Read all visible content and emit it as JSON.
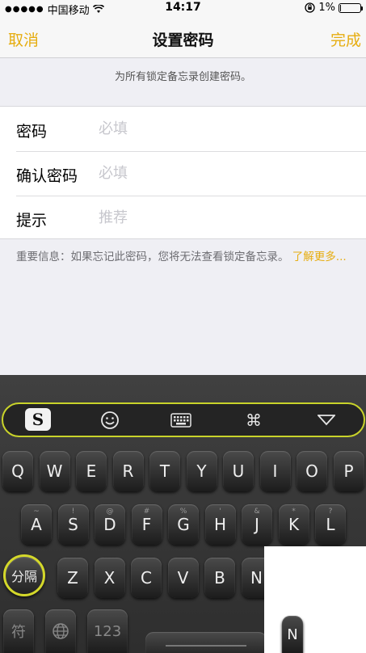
{
  "status_bar": {
    "carrier": "中国移动",
    "time": "14:17",
    "battery": "1%",
    "battery_level": 0.01,
    "icons": [
      "signal-dots-icon",
      "wifi-icon",
      "orientation-lock-icon",
      "battery-icon"
    ]
  },
  "nav": {
    "cancel": "取消",
    "title": "设置密码",
    "done": "完成",
    "accent_color": "#e6ad10"
  },
  "notice": "为所有锁定备忘录创建密码。",
  "form": {
    "password_label": "密码",
    "password_placeholder": "必填",
    "confirm_label": "确认密码",
    "confirm_placeholder": "必填",
    "hint_label": "提示",
    "hint_placeholder": "推荐"
  },
  "info": {
    "text": "重要信息：如果忘记此密码，您将无法查看锁定备忘录。",
    "link": "了解更多..."
  },
  "keyboard": {
    "toolbar_icons": [
      "sogou-logo-icon",
      "emoji-icon",
      "keyboard-icon",
      "command-icon",
      "collapse-icon"
    ],
    "sogou_label": "S",
    "row1": [
      "Q",
      "W",
      "E",
      "R",
      "T",
      "Y",
      "U",
      "I",
      "O",
      "P"
    ],
    "row2": [
      "A",
      "S",
      "D",
      "F",
      "G",
      "H",
      "J",
      "K",
      "L"
    ],
    "row2_subs": [
      "~",
      "!",
      "@",
      "#",
      "%",
      "'",
      "&",
      "*",
      "?"
    ],
    "row3": [
      "Z",
      "X",
      "C",
      "V",
      "B",
      "N"
    ],
    "separator_key": "分隔",
    "symbol_key": "符",
    "number_key": "123",
    "globe_icon": "globe-icon",
    "partial_key": "N"
  }
}
